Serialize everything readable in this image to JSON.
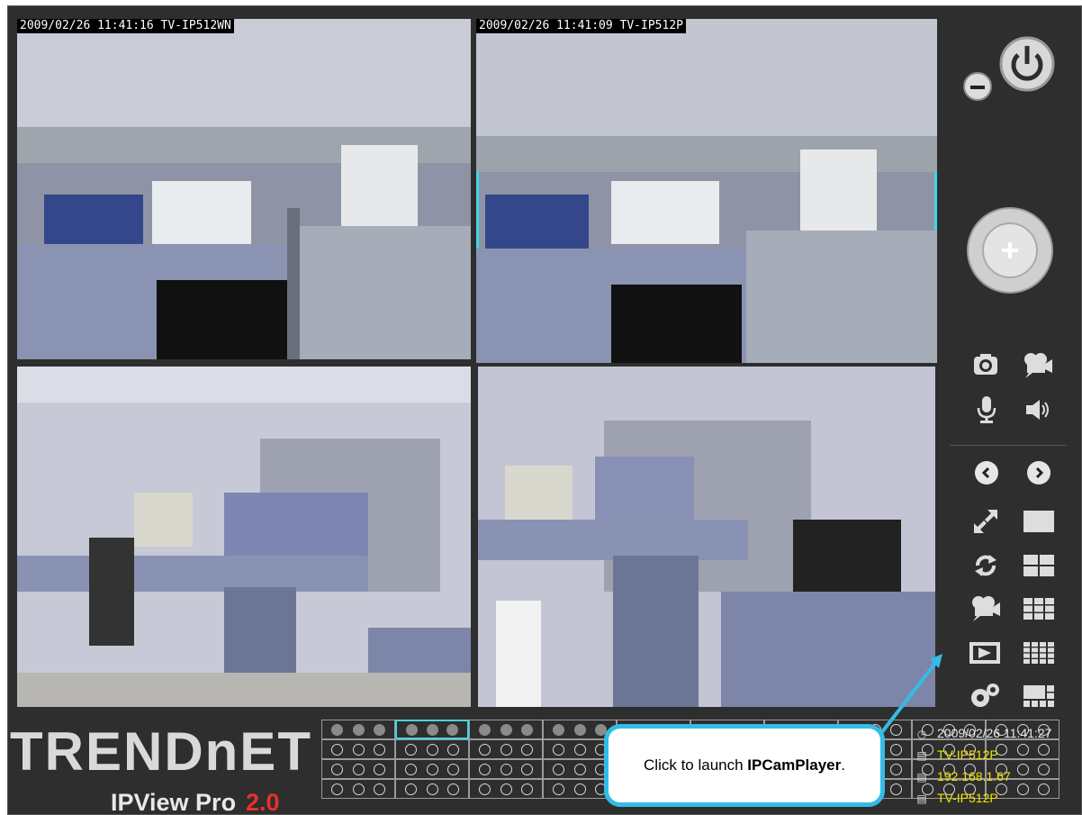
{
  "cameras": [
    {
      "timestamp": "2009/02/26 11:41:16 TV-IP512WN",
      "selected": false
    },
    {
      "timestamp": "2009/02/26 11:41:09 TV-IP512P",
      "selected": true
    },
    {
      "timestamp": "",
      "selected": false
    },
    {
      "timestamp": "",
      "selected": false
    }
  ],
  "controls": {
    "icons": [
      "minimize-icon",
      "power-icon",
      "ptz-joystick-icon",
      "snapshot-icon",
      "record-icon",
      "microphone-icon",
      "speaker-icon",
      "previous-icon",
      "next-icon",
      "fullscreen-icon",
      "layout-1-icon",
      "patrol-icon",
      "layout-4-icon",
      "playback-camera-icon",
      "layout-9-icon",
      "ipcamplayer-icon",
      "layout-16-icon",
      "settings-icon",
      "layout-custom-icon"
    ]
  },
  "branding": {
    "logo": "TRENDnET",
    "product": "IPView Pro",
    "version": "2.0"
  },
  "status": {
    "datetime": "2009/02/26 11:41:27",
    "camera_name": "TV-IP512P",
    "ip_address": "192.168.1.67",
    "model": "TV-IP512P"
  },
  "callout": {
    "text_prefix": "Click to launch ",
    "text_bold": "IPCamPlayer",
    "text_suffix": "."
  },
  "colors": {
    "accent": "#3fd6e6",
    "callout_border": "#33bde6",
    "status_yellow": "#f2e600",
    "panel_bg": "#2e2e2e"
  }
}
